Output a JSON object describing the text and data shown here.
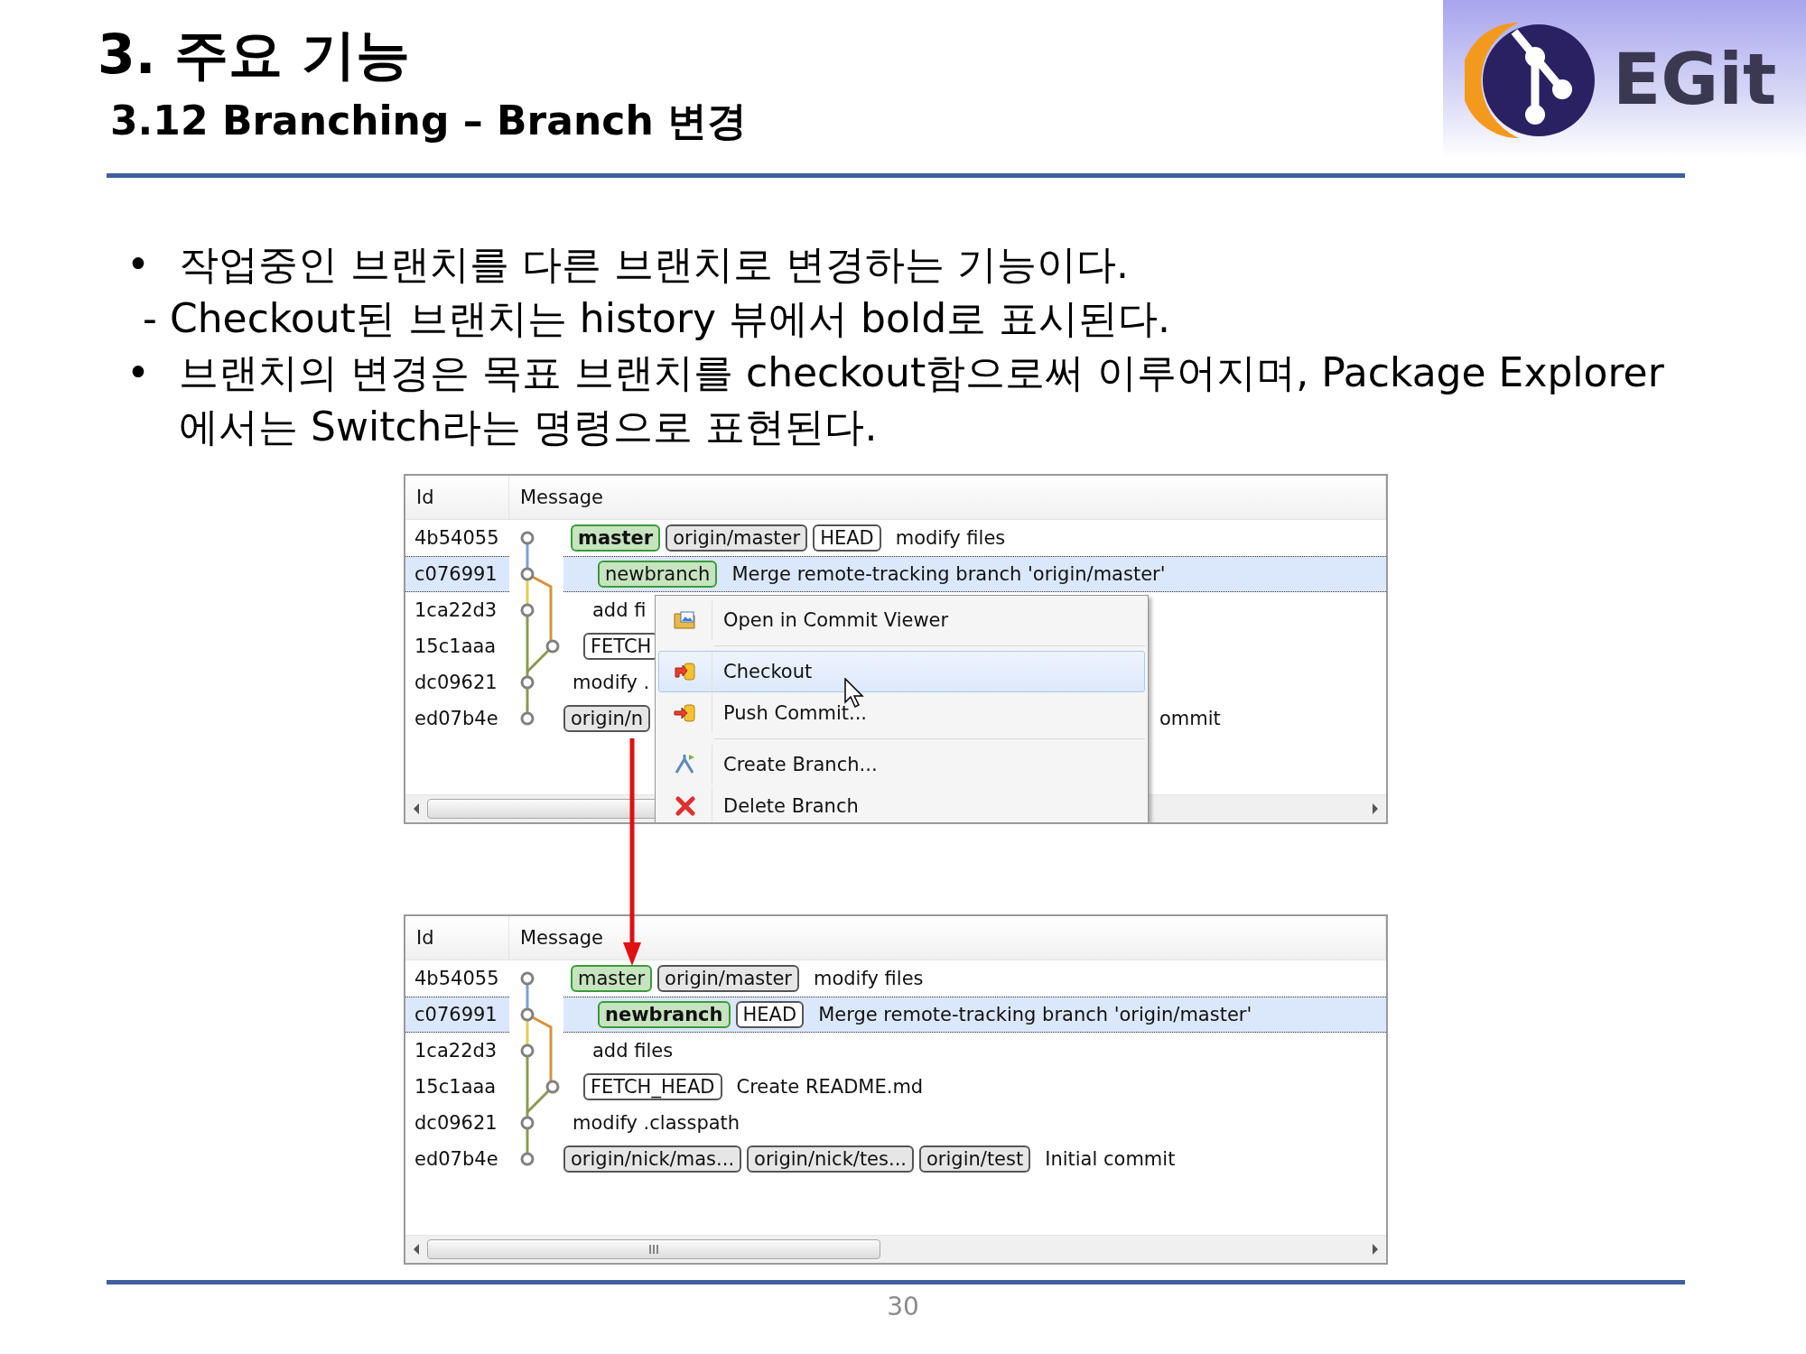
{
  "header": {
    "title": "3. 주요 기능",
    "subtitle": "3.12 Branching – Branch 변경"
  },
  "logo": {
    "text": "EGit"
  },
  "bullets": [
    {
      "kind": "bullet",
      "marker": "•",
      "text": "작업중인 브랜치를 다른 브랜치로 변경하는 기능이다."
    },
    {
      "kind": "dash",
      "marker": "-",
      "text": "Checkout된 브랜치는 history 뷰에서 bold로 표시된다."
    },
    {
      "kind": "bullet",
      "marker": "•",
      "text": "브랜치의 변경은 목표 브랜치를 checkout함으로써 이루어지며, Package Explorer에서는 Switch라는 명령으로 표현된다."
    }
  ],
  "history_views": [
    {
      "columns": [
        "Id",
        "Message"
      ],
      "rows": [
        {
          "id": "4b54055",
          "selected": false,
          "refs": [
            {
              "label": "master",
              "kind": "local",
              "checked_out": true
            },
            {
              "label": "origin/master",
              "kind": "remote",
              "checked_out": false
            },
            {
              "label": "HEAD",
              "kind": "ref",
              "checked_out": false
            }
          ],
          "message": "modify files"
        },
        {
          "id": "c076991",
          "selected": true,
          "refs": [
            {
              "label": "newbranch",
              "kind": "local",
              "checked_out": false
            }
          ],
          "message": "Merge remote-tracking branch 'origin/master'"
        },
        {
          "id": "1ca22d3",
          "selected": false,
          "refs": [],
          "message": "add fi"
        },
        {
          "id": "15c1aaa",
          "selected": false,
          "refs": [
            {
              "label": "FETCH",
              "kind": "ref",
              "checked_out": false
            }
          ]
        },
        {
          "id": "dc09621",
          "selected": false,
          "refs": [],
          "message": "modify ."
        },
        {
          "id": "ed07b4e",
          "selected": false,
          "refs": [
            {
              "label": "origin/n",
              "kind": "remote",
              "checked_out": false
            }
          ],
          "trailing": "ommit"
        }
      ],
      "context_menu": {
        "items": [
          {
            "kind": "item",
            "label": "Open in Commit Viewer",
            "selected": false
          },
          {
            "kind": "separator"
          },
          {
            "kind": "item",
            "label": "Checkout",
            "selected": true
          },
          {
            "kind": "item",
            "label": "Push Commit...",
            "selected": false
          },
          {
            "kind": "separator"
          },
          {
            "kind": "item",
            "label": "Create Branch...",
            "selected": false
          },
          {
            "kind": "item",
            "label": "Delete Branch",
            "selected": false
          }
        ]
      }
    },
    {
      "columns": [
        "Id",
        "Message"
      ],
      "rows": [
        {
          "id": "4b54055",
          "selected": false,
          "refs": [
            {
              "label": "master",
              "kind": "local",
              "checked_out": false
            },
            {
              "label": "origin/master",
              "kind": "remote",
              "checked_out": false
            }
          ],
          "message": "modify files"
        },
        {
          "id": "c076991",
          "selected": true,
          "refs": [
            {
              "label": "newbranch",
              "kind": "local",
              "checked_out": true
            },
            {
              "label": "HEAD",
              "kind": "ref",
              "checked_out": false
            }
          ],
          "message": "Merge remote-tracking branch 'origin/master'"
        },
        {
          "id": "1ca22d3",
          "selected": false,
          "refs": [],
          "message": "add files"
        },
        {
          "id": "15c1aaa",
          "selected": false,
          "refs": [
            {
              "label": "FETCH_HEAD",
              "kind": "ref",
              "checked_out": false
            }
          ],
          "message": "Create README.md"
        },
        {
          "id": "dc09621",
          "selected": false,
          "refs": [],
          "message": "modify .classpath"
        },
        {
          "id": "ed07b4e",
          "selected": false,
          "refs": [
            {
              "label": "origin/nick/mas...",
              "kind": "remote",
              "checked_out": false
            },
            {
              "label": "origin/nick/tes...",
              "kind": "remote",
              "checked_out": false
            },
            {
              "label": "origin/test",
              "kind": "remote",
              "checked_out": false
            }
          ],
          "message": "Initial commit"
        }
      ]
    }
  ],
  "page_number": "30"
}
